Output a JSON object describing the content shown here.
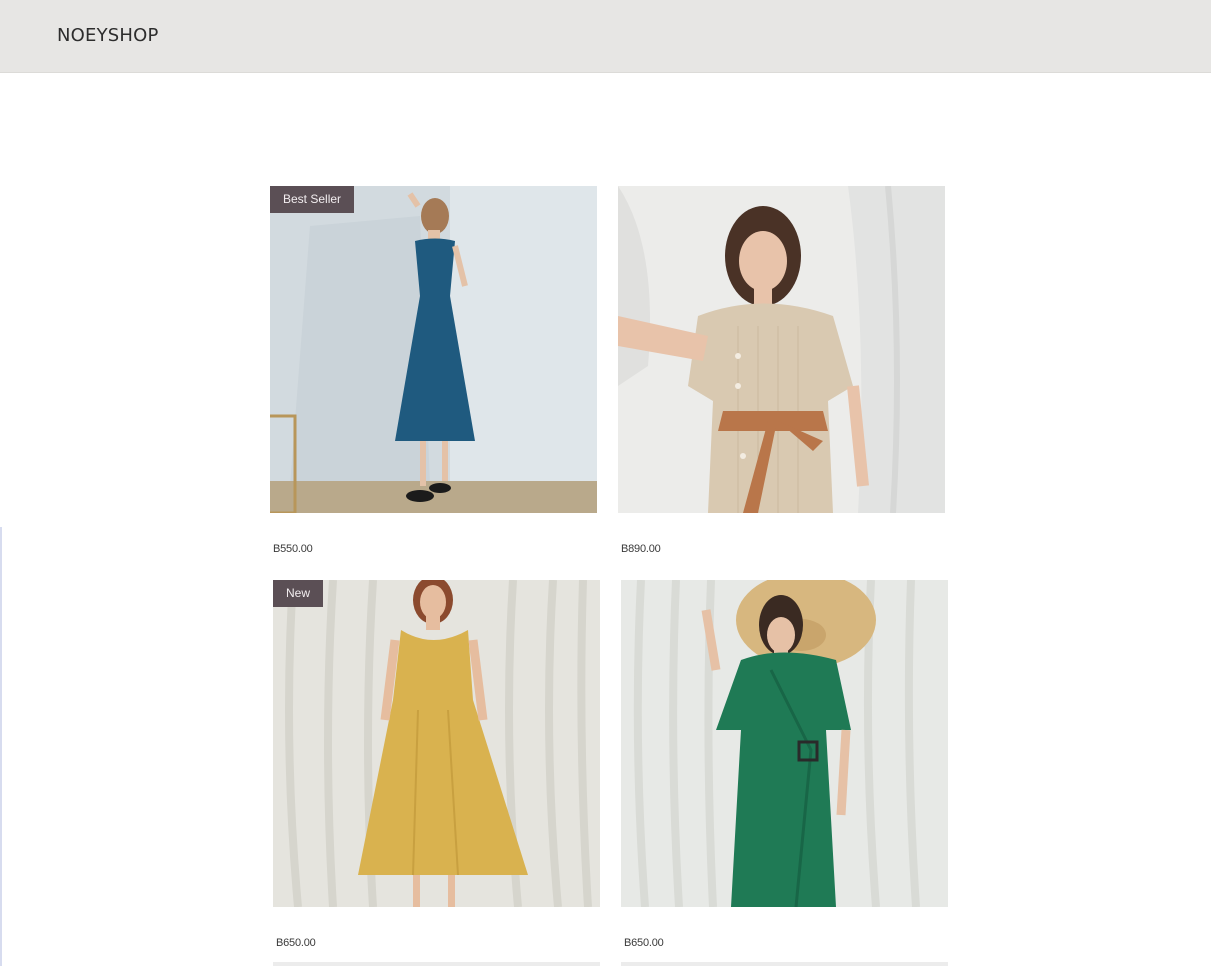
{
  "header": {
    "brand": "NOEYSHOP"
  },
  "products": [
    {
      "badge": "Best Seller",
      "price": "B550.00",
      "image": "woman-blue-midi-dress"
    },
    {
      "badge": "",
      "price": "B890.00",
      "image": "woman-beige-striped-dress-brown-bow"
    },
    {
      "badge": "New",
      "price": "B650.00",
      "image": "woman-yellow-sleeveless-dress"
    },
    {
      "badge": "",
      "price": "B650.00",
      "image": "woman-green-wrap-dress-straw-hat"
    }
  ],
  "colors": {
    "header_bg": "#e7e6e4",
    "badge_bg": "#5b4f55",
    "dress_blue": "#1f5a7f",
    "dress_beige": "#d9c9b1",
    "ribbon_brown": "#b9764a",
    "dress_yellow": "#d9b24f",
    "dress_green": "#1f7a55",
    "hat_straw": "#d7b77f"
  }
}
